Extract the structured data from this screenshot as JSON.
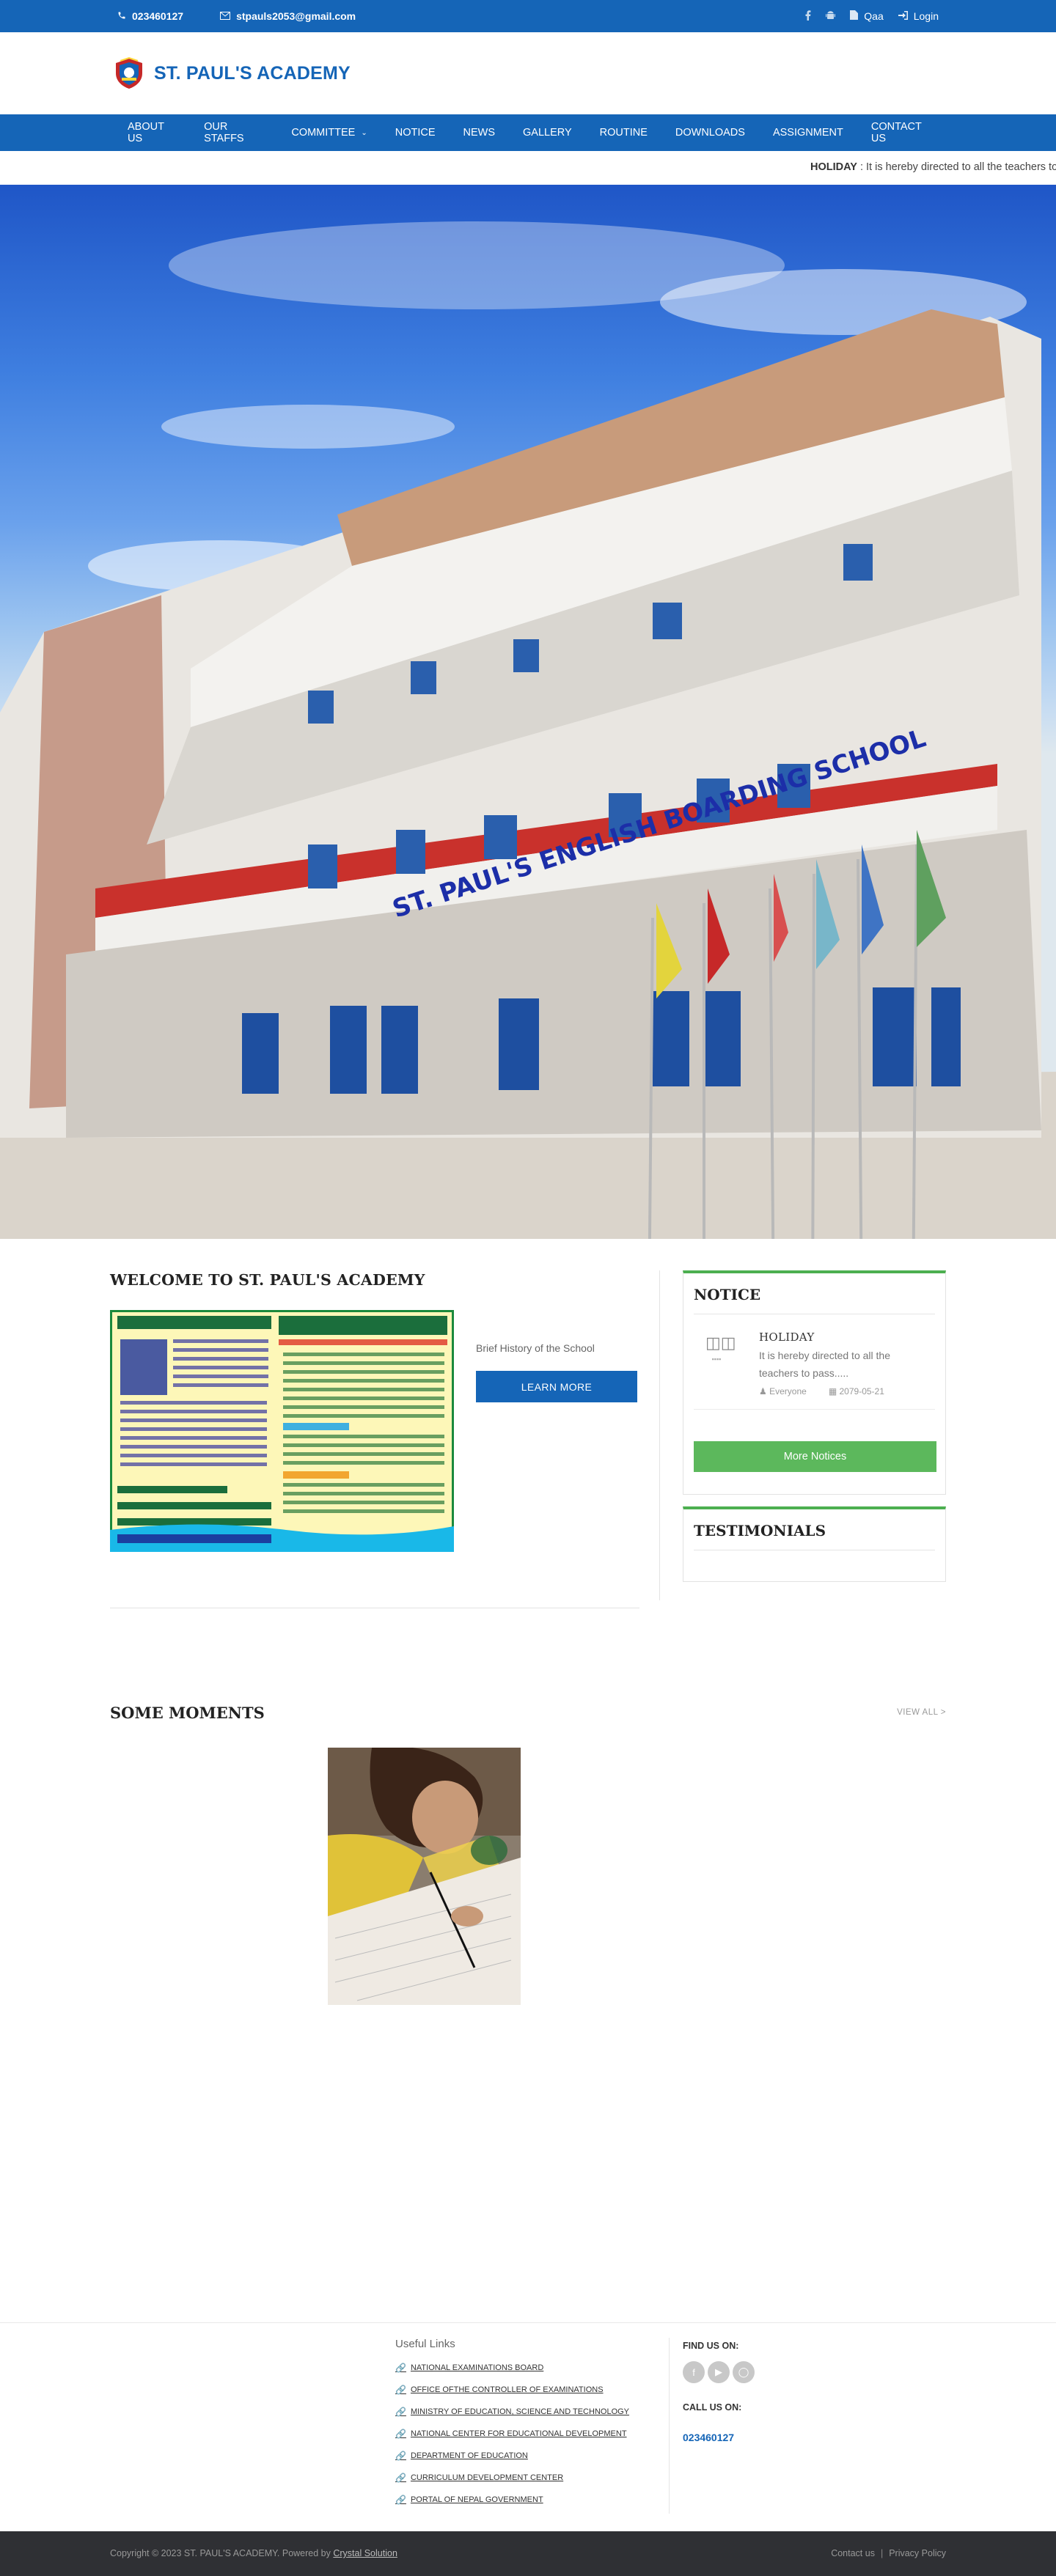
{
  "topbar": {
    "phone": "023460127",
    "email": "stpauls2053@gmail.com",
    "qaa": "Qaa",
    "login": "Login",
    "icons": [
      "phone-icon",
      "mail-icon",
      "facebook-icon",
      "android-icon",
      "document-icon",
      "login-icon"
    ]
  },
  "header": {
    "site_name": "ST. PAUL'S ACADEMY"
  },
  "nav": {
    "items": [
      "ABOUT US",
      "OUR STAFFS",
      "COMMITTEE",
      "NOTICE",
      "NEWS",
      "GALLERY",
      "ROUTINE",
      "DOWNLOADS",
      "ASSIGNMENT",
      "CONTACT US"
    ]
  },
  "ticker": {
    "label": "HOLIDAY",
    "text": ": It is hereby directed to all the teachers to pass....."
  },
  "hero": {
    "banner_text": "ST. PAUL'S ENGLISH BOARDING SCHOOL"
  },
  "welcome": {
    "title": "WELCOME TO ST. PAUL'S ACADEMY",
    "history": "Brief History of the School",
    "learn_more": "LEARN MORE"
  },
  "notice": {
    "title": "NOTICE",
    "entry": {
      "title": "HOLIDAY",
      "desc": "It is hereby directed to all the teachers to pass.....",
      "audience": "Everyone",
      "date": "2079-05-21"
    },
    "more": "More Notices"
  },
  "testimonials": {
    "title": "TESTIMONIALS"
  },
  "moments": {
    "title": "SOME MOMENTS",
    "view_all": "VIEW ALL >"
  },
  "footer": {
    "useful_links_title": "Useful Links",
    "links": [
      "NATIONAL EXAMINATIONS BOARD",
      "OFFICE OFTHE CONTROLLER OF EXAMINATIONS",
      "MINISTRY OF EDUCATION, SCIENCE AND TECHNOLOGY",
      "NATIONAL CENTER FOR EDUCATIONAL DEVELOPMENT",
      "DEPARTMENT OF EDUCATION",
      "CURRICULUM DEVELOPMENT CENTER",
      "PORTAL OF NEPAL GOVERNMENT"
    ],
    "find_us": "FIND US ON:",
    "call_us": "CALL US ON:",
    "phone": "023460127"
  },
  "bottom": {
    "copyright": "Copyright © 2023 ST. PAUL'S ACADEMY. Powered by",
    "powered": "Crystal Solution",
    "contact": "Contact us",
    "privacy": "Privacy Policy"
  },
  "colors": {
    "primary": "#1565b7",
    "green": "#5cb85c",
    "footer_dark": "#2f3034"
  }
}
